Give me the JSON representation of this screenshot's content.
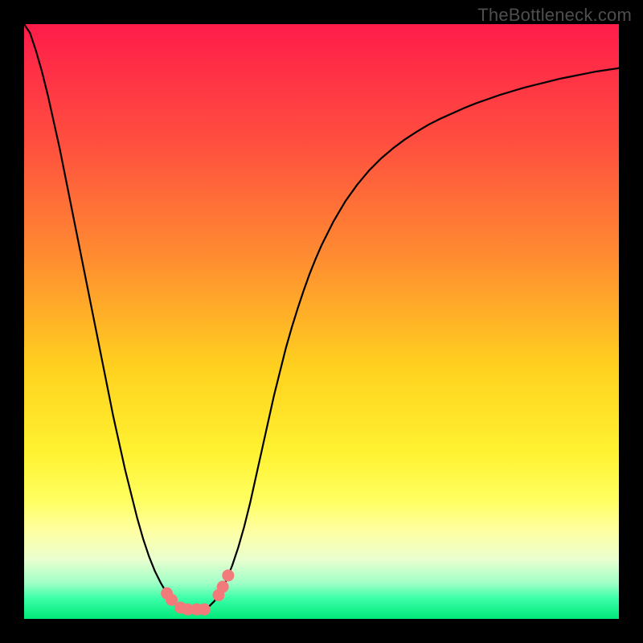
{
  "watermark": "TheBottleneck.com",
  "chart_data": {
    "type": "line",
    "title": "",
    "xlabel": "",
    "ylabel": "",
    "xlim": [
      0,
      100
    ],
    "ylim": [
      0,
      100
    ],
    "grid": false,
    "legend": false,
    "background_gradient": {
      "stops": [
        {
          "pos": 0.0,
          "color": "#ff1c4a"
        },
        {
          "pos": 0.2,
          "color": "#ff4f3f"
        },
        {
          "pos": 0.4,
          "color": "#ff8f30"
        },
        {
          "pos": 0.58,
          "color": "#ffd21f"
        },
        {
          "pos": 0.72,
          "color": "#fff231"
        },
        {
          "pos": 0.8,
          "color": "#ffff60"
        },
        {
          "pos": 0.85,
          "color": "#ffffa0"
        },
        {
          "pos": 0.9,
          "color": "#e9ffcf"
        },
        {
          "pos": 0.94,
          "color": "#9fffc6"
        },
        {
          "pos": 0.965,
          "color": "#3dffa8"
        },
        {
          "pos": 1.0,
          "color": "#00e87b"
        }
      ]
    },
    "series": [
      {
        "name": "bottleneck-curve",
        "stroke": "#000000",
        "stroke_width": 2.2,
        "x": [
          0.0,
          1.0,
          2.0,
          3.0,
          4.0,
          5.0,
          6.0,
          7.0,
          8.0,
          9.0,
          10.0,
          11.0,
          12.0,
          13.0,
          14.0,
          15.0,
          16.0,
          17.0,
          18.0,
          19.0,
          20.0,
          21.0,
          22.0,
          23.0,
          24.0,
          25.0,
          26.0,
          27.0,
          28.0,
          29.0,
          30.0,
          31.0,
          32.0,
          33.0,
          34.0,
          35.0,
          36.0,
          37.0,
          38.0,
          39.0,
          40.0,
          41.0,
          42.0,
          43.0,
          44.0,
          45.0,
          46.0,
          47.0,
          48.0,
          49.0,
          50.0,
          52.0,
          54.0,
          56.0,
          58.0,
          60.0,
          62.0,
          64.0,
          66.0,
          68.0,
          70.0,
          72.0,
          74.0,
          76.0,
          78.0,
          80.0,
          82.0,
          84.0,
          86.0,
          88.0,
          90.0,
          92.0,
          94.0,
          96.0,
          98.0,
          100.0
        ],
        "y": [
          0.0,
          1.5,
          4.5,
          8.0,
          12.0,
          16.5,
          21.0,
          26.0,
          31.0,
          36.0,
          41.0,
          46.0,
          51.0,
          56.0,
          61.0,
          66.0,
          70.5,
          75.0,
          79.0,
          83.0,
          86.5,
          89.5,
          92.0,
          94.0,
          95.7,
          97.0,
          97.9,
          98.3,
          98.4,
          98.4,
          98.4,
          98.0,
          97.0,
          95.5,
          93.5,
          91.0,
          88.0,
          84.5,
          80.5,
          76.0,
          71.5,
          67.0,
          62.5,
          58.5,
          54.5,
          51.0,
          47.8,
          44.8,
          42.0,
          39.5,
          37.2,
          33.2,
          29.8,
          27.0,
          24.6,
          22.6,
          20.9,
          19.4,
          18.1,
          16.9,
          15.9,
          15.0,
          14.1,
          13.3,
          12.6,
          11.9,
          11.3,
          10.7,
          10.2,
          9.7,
          9.2,
          8.8,
          8.4,
          8.0,
          7.7,
          7.4
        ]
      }
    ],
    "markers": {
      "name": "highlighted-points",
      "fill": "#f37a7a",
      "stroke": "#f37a7a",
      "radius_px": 7,
      "points": [
        {
          "x": 24.0,
          "y": 95.7
        },
        {
          "x": 24.8,
          "y": 96.8
        },
        {
          "x": 26.3,
          "y": 98.1
        },
        {
          "x": 27.5,
          "y": 98.4
        },
        {
          "x": 29.0,
          "y": 98.4
        },
        {
          "x": 30.3,
          "y": 98.4
        },
        {
          "x": 32.7,
          "y": 96.0
        },
        {
          "x": 33.4,
          "y": 94.6
        },
        {
          "x": 34.3,
          "y": 92.7
        }
      ]
    }
  }
}
